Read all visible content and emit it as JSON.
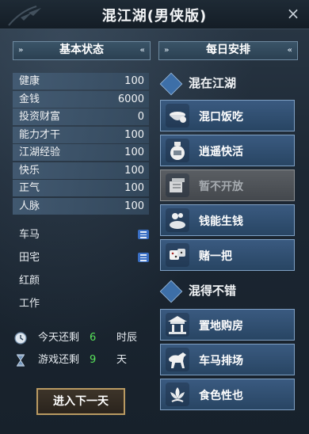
{
  "window": {
    "title": "混江湖(男侠版)",
    "close_label": "×"
  },
  "left_panel": {
    "header": "基本状态",
    "stats": [
      {
        "label": "健康",
        "value": "100"
      },
      {
        "label": "金钱",
        "value": "6000"
      },
      {
        "label": "投资财富",
        "value": "0"
      },
      {
        "label": "能力才干",
        "value": "100"
      },
      {
        "label": "江湖经验",
        "value": "100"
      },
      {
        "label": "快乐",
        "value": "100"
      },
      {
        "label": "正气",
        "value": "100"
      },
      {
        "label": "人脉",
        "value": "100"
      }
    ],
    "assets": [
      {
        "label": "车马",
        "has_list": true
      },
      {
        "label": "田宅",
        "has_list": true
      },
      {
        "label": "红颜",
        "has_list": false
      },
      {
        "label": "工作",
        "has_list": false
      }
    ],
    "timers": [
      {
        "label": "今天还剩",
        "value": "6",
        "unit": "时辰"
      },
      {
        "label": "游戏还剩",
        "value": "9",
        "unit": "天"
      }
    ],
    "next_button": "进入下一天"
  },
  "right_panel": {
    "header": "每日安排",
    "group1": {
      "title": "混在江湖",
      "actions": [
        {
          "label": "混口饭吃",
          "icon": "rice-bowl-icon",
          "enabled": true
        },
        {
          "label": "逍遥快活",
          "icon": "wine-jar-icon",
          "enabled": true
        },
        {
          "label": "暂不开放",
          "icon": "book-stack-icon",
          "enabled": false
        },
        {
          "label": "钱能生钱",
          "icon": "money-bag-icon",
          "enabled": true
        },
        {
          "label": "赌一把",
          "icon": "dice-icon",
          "enabled": true
        }
      ]
    },
    "group2": {
      "title": "混得不错",
      "actions": [
        {
          "label": "置地购房",
          "icon": "house-icon",
          "enabled": true
        },
        {
          "label": "车马排场",
          "icon": "horse-icon",
          "enabled": true
        },
        {
          "label": "食色性也",
          "icon": "lotus-icon",
          "enabled": true
        }
      ]
    }
  },
  "colors": {
    "accent_blue": "#3a5a80",
    "timer_green": "#58e35a",
    "button_gold": "#b99a62"
  }
}
